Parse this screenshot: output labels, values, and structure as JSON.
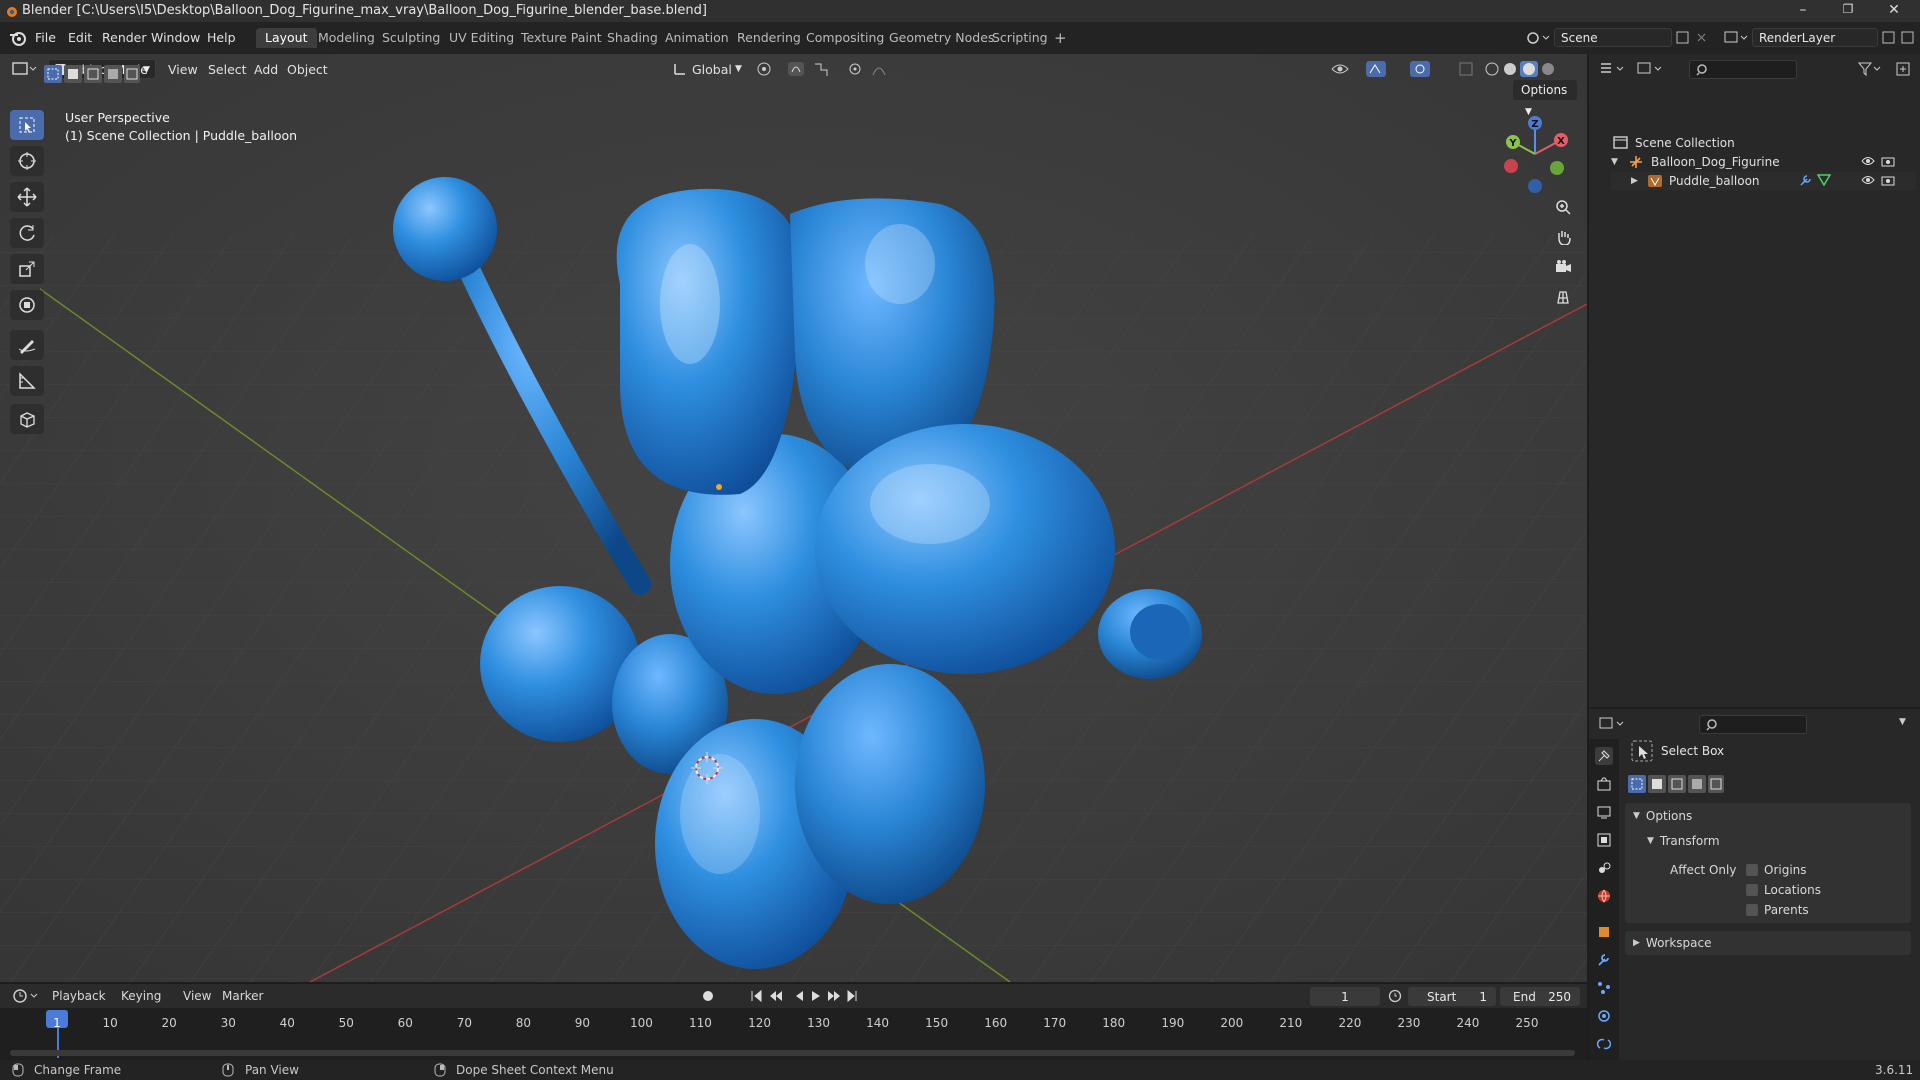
{
  "window": {
    "title": "Blender [C:\\Users\\I5\\Desktop\\Balloon_Dog_Figurine_max_vray\\Balloon_Dog_Figurine_blender_base.blend]",
    "minimize": "–",
    "maximize": "❐",
    "close": "✕"
  },
  "menubar": {
    "items": [
      "File",
      "Edit",
      "Render",
      "Window",
      "Help"
    ],
    "workspaces": [
      "Layout",
      "Modeling",
      "Sculpting",
      "UV Editing",
      "Texture Paint",
      "Shading",
      "Animation",
      "Rendering",
      "Compositing",
      "Geometry Nodes",
      "Scripting"
    ],
    "add_workspace": "+",
    "scene_label": "Scene",
    "view_layer_label": "RenderLayer"
  },
  "viewport": {
    "mode": "Object Mode",
    "menus": [
      "View",
      "Select",
      "Add",
      "Object"
    ],
    "orientation": "Global",
    "options_label": "Options",
    "overlay_line1": "User Perspective",
    "overlay_line2": "(1) Scene Collection | Puddle_balloon",
    "gizmo_labels": {
      "x": "X",
      "y": "Y",
      "z": "Z"
    },
    "object_color": "#2f8fe0"
  },
  "outliner": {
    "root": "Scene Collection",
    "items": [
      {
        "name": "Balloon_Dog_Figurine"
      },
      {
        "name": "Puddle_balloon"
      }
    ]
  },
  "properties": {
    "tool_name": "Select Box",
    "options_label": "Options",
    "transform_label": "Transform",
    "affect_only_label": "Affect Only",
    "checkboxes": [
      "Origins",
      "Locations",
      "Parents"
    ],
    "workspace_label": "Workspace"
  },
  "timeline": {
    "menus": [
      "Playback",
      "Keying",
      "View",
      "Marker"
    ],
    "current_frame": "1",
    "start_label": "Start",
    "start_value": "1",
    "end_label": "End",
    "end_value": "250",
    "ticks": [
      "1",
      "10",
      "20",
      "30",
      "40",
      "50",
      "60",
      "70",
      "80",
      "90",
      "100",
      "110",
      "120",
      "130",
      "140",
      "150",
      "160",
      "170",
      "180",
      "190",
      "200",
      "210",
      "220",
      "230",
      "240",
      "250"
    ]
  },
  "statusbar": {
    "items": [
      "Change Frame",
      "Pan View",
      "Dope Sheet Context Menu"
    ],
    "version": "3.6.11"
  }
}
